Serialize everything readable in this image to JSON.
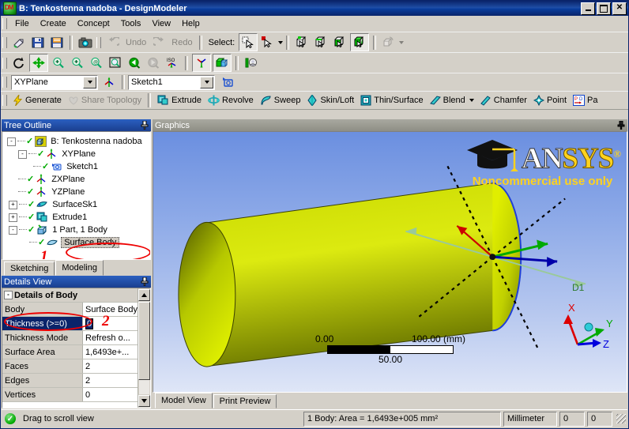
{
  "window": {
    "title": "B: Tenkostenna nadoba - DesignModeler",
    "app_icon": "designmodeler-icon",
    "minimize_label": "",
    "maximize_label": "",
    "close_label": "✕"
  },
  "menu": {
    "items": [
      {
        "label": "File"
      },
      {
        "label": "Create"
      },
      {
        "label": "Concept"
      },
      {
        "label": "Tools"
      },
      {
        "label": "View"
      },
      {
        "label": "Help"
      }
    ]
  },
  "toolbar_standard": {
    "buttons": [
      {
        "name": "new-icon",
        "tooltip": "New"
      },
      {
        "name": "save-icon",
        "tooltip": "Save"
      },
      {
        "name": "save-as-icon",
        "tooltip": "Save As"
      },
      {
        "name": "image-capture-icon",
        "tooltip": "Image Capture"
      }
    ],
    "undo_label": "Undo",
    "redo_label": "Redo",
    "select_label": "Select:",
    "select_buttons": [
      {
        "name": "select-mode-single-icon"
      },
      {
        "name": "select-mode-box-icon"
      },
      {
        "name": "select-vertices-icon"
      },
      {
        "name": "select-edges-icon"
      },
      {
        "name": "select-faces-icon"
      },
      {
        "name": "select-bodies-icon"
      },
      {
        "name": "extend-selection-icon"
      }
    ]
  },
  "toolbar_view": {
    "buttons": [
      {
        "name": "rotate-icon"
      },
      {
        "name": "pan-icon"
      },
      {
        "name": "zoom-icon"
      },
      {
        "name": "box-zoom-icon"
      },
      {
        "name": "zoom-to-fit-icon"
      },
      {
        "name": "magnify-icon"
      },
      {
        "name": "previous-view-icon"
      },
      {
        "name": "next-view-icon"
      },
      {
        "name": "iso-view-icon"
      },
      {
        "name": "look-at-icon"
      },
      {
        "name": "display-model-icon"
      },
      {
        "name": "display-plane-icon"
      }
    ]
  },
  "selector_row": {
    "plane_value": "XYPlane",
    "plane_options": [
      "XYPlane",
      "ZXPlane",
      "YZPlane"
    ],
    "new_plane_icon": "new-plane-icon",
    "sketch_value": "Sketch1",
    "sketch_options": [
      "Sketch1"
    ],
    "new_sketch_icon": "new-sketch-icon"
  },
  "toolbar_features": {
    "items": [
      {
        "label": "Generate",
        "icon": "lightning-icon",
        "enabled": true
      },
      {
        "label": "Share Topology",
        "icon": "heart-icon",
        "enabled": false
      },
      {
        "label": "Extrude",
        "icon": "extrude-icon",
        "enabled": true
      },
      {
        "label": "Revolve",
        "icon": "revolve-icon",
        "enabled": true
      },
      {
        "label": "Sweep",
        "icon": "sweep-icon",
        "enabled": true
      },
      {
        "label": "Skin/Loft",
        "icon": "skinloft-icon",
        "enabled": true
      },
      {
        "label": "Thin/Surface",
        "icon": "thinsurface-icon",
        "enabled": true
      },
      {
        "label": "Blend",
        "icon": "blend-icon",
        "enabled": true,
        "has_arrow": true
      },
      {
        "label": "Chamfer",
        "icon": "chamfer-icon",
        "enabled": true
      },
      {
        "label": "Point",
        "icon": "point-icon",
        "enabled": true
      },
      {
        "label": "Pa",
        "icon": "parameters-icon",
        "enabled": true
      }
    ]
  },
  "tree_panel": {
    "title": "Tree Outline",
    "pin_icon": "pin-icon",
    "nodes": [
      {
        "label": "B: Tenkostenna nadoba",
        "indent": 0,
        "expander": "-",
        "icon": "model-icon",
        "check": true,
        "selected": false
      },
      {
        "label": "XYPlane",
        "indent": 1,
        "expander": "-",
        "icon": "plane-icon",
        "check": true,
        "selected": false
      },
      {
        "label": "Sketch1",
        "indent": 2,
        "expander": "",
        "icon": "sketch-icon",
        "check": true,
        "selected": false
      },
      {
        "label": "ZXPlane",
        "indent": 1,
        "expander": "",
        "icon": "plane-icon",
        "check": true,
        "selected": false
      },
      {
        "label": "YZPlane",
        "indent": 1,
        "expander": "",
        "icon": "plane-icon",
        "check": true,
        "selected": false
      },
      {
        "label": "SurfaceSk1",
        "indent": 1,
        "expander": "+",
        "icon": "surface-icon",
        "check": true,
        "selected": false
      },
      {
        "label": "Extrude1",
        "indent": 1,
        "expander": "+",
        "icon": "extrude-icon",
        "check": true,
        "selected": false
      },
      {
        "label": "1 Part, 1 Body",
        "indent": 1,
        "expander": "-",
        "icon": "part-icon",
        "check": true,
        "selected": false
      },
      {
        "label": "Surface Body",
        "indent": 2,
        "expander": "",
        "icon": "body-icon",
        "check": true,
        "selected": true
      }
    ],
    "annotation_number": "1"
  },
  "mode_tabs": {
    "items": [
      {
        "label": "Sketching",
        "active": false
      },
      {
        "label": "Modeling",
        "active": true
      }
    ]
  },
  "details_panel": {
    "title": "Details View",
    "pin_icon": "pin-icon",
    "group_label": "Details of Body",
    "group_expander": "-",
    "rows": [
      {
        "key": "Body",
        "value": "Surface Body",
        "selected": false,
        "editing": false
      },
      {
        "key": "Thickness (>=0)",
        "value": "0",
        "selected": true,
        "editing": true
      },
      {
        "key": "Thickness Mode",
        "value": "Refresh o...",
        "selected": false,
        "editing": false
      },
      {
        "key": "Surface Area",
        "value": "1,6493e+...",
        "selected": false,
        "editing": false
      },
      {
        "key": "Faces",
        "value": "2",
        "selected": false,
        "editing": false
      },
      {
        "key": "Edges",
        "value": "2",
        "selected": false,
        "editing": false
      },
      {
        "key": "Vertices",
        "value": "0",
        "selected": false,
        "editing": false
      }
    ],
    "annotation_number": "2",
    "scroll_up_icon": "scroll-up-icon",
    "scroll_down_icon": "scroll-down-icon"
  },
  "graphics_panel": {
    "title": "Graphics",
    "pin_icon": "pin-icon",
    "watermark": {
      "logo_text_white": "AN",
      "logo_text_gold": "SYS",
      "registered_mark": "®",
      "subtitle": "Noncommercial use only",
      "cap_icon": "graduation-cap-icon"
    },
    "scale_bar": {
      "min": "0.00",
      "max": "100.00 (mm)",
      "mid": "50.00"
    },
    "triad": {
      "x_label": "X",
      "y_label": "Y",
      "z_label": "Z",
      "x_color": "#dd0000",
      "y_color": "#00aa00",
      "z_color": "#0000dd"
    },
    "dimension_label": "D1",
    "body_color": "#d2e000"
  },
  "view_tabs": {
    "items": [
      {
        "label": "Model View",
        "active": true
      },
      {
        "label": "Print Preview",
        "active": false
      }
    ]
  },
  "status_bar": {
    "icon": "ready-check-icon",
    "hint": "Drag to scroll view",
    "selection_info": "1 Body: Area = 1,6493e+005 mm²",
    "unit": "Millimeter",
    "field1": "0",
    "field2": "0"
  },
  "colors": {
    "title_bar": "#0a246a",
    "panel_bg": "#d4d0c8",
    "annotation_red": "#e00000",
    "accent_cyan": "#00c8d2",
    "logo_gold": "#ffd21e"
  }
}
